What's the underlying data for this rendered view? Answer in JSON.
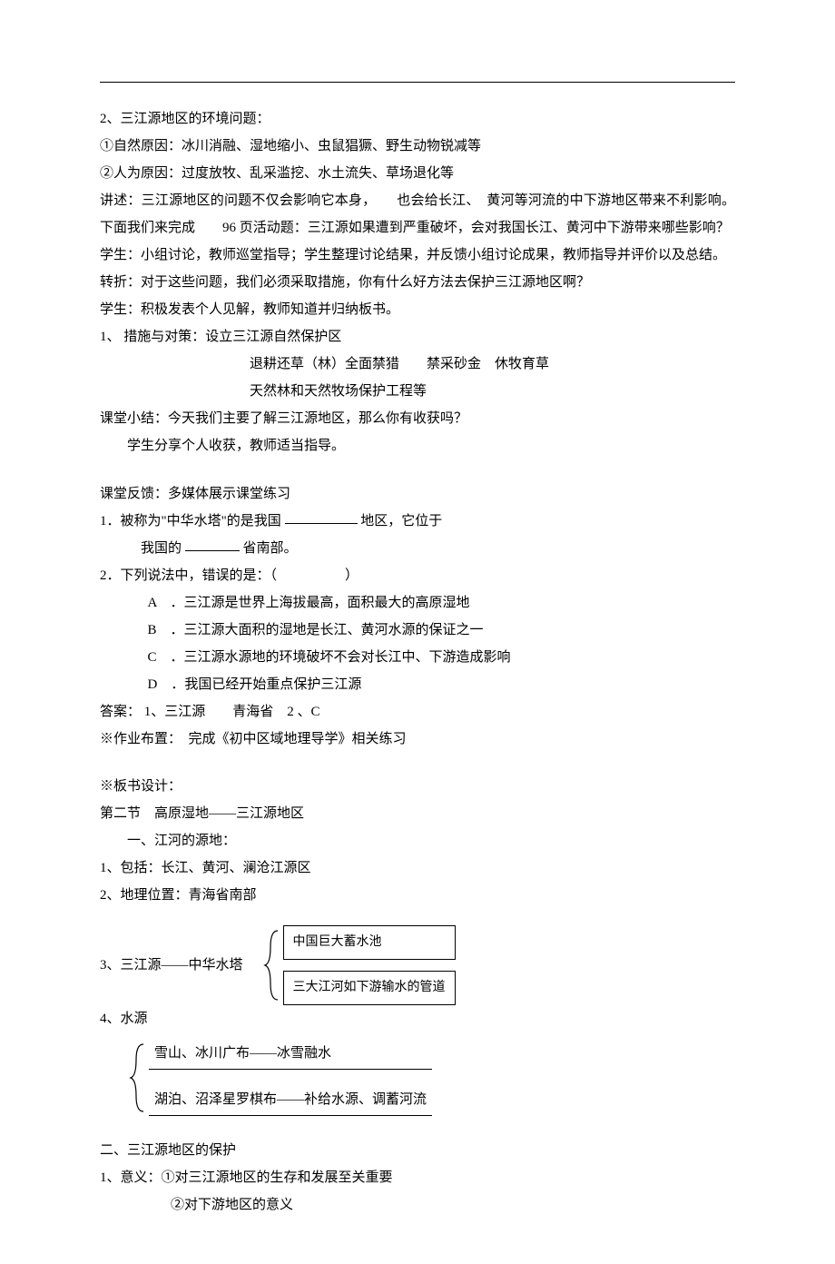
{
  "l1": "2、三江源地区的环境问题：",
  "l2": "①自然原因：冰川消融、湿地缩小、虫鼠猖獗、野生动物锐减等",
  "l3": "②人为原因：过度放牧、乱采滥挖、水土流失、草场退化等",
  "l4": "讲述：三江源地区的问题不仅会影响它本身，　　也会给长江、　黄河等河流的中下游地区带来不利影响。下面我们来完成　　96 页活动题：三江源如果遭到严重破坏，会对我国长江、黄河中下游带来哪些影响？",
  "l5": "学生：小组讨论，教师巡堂指导；学生整理讨论结果，并反馈小组讨论成果，教师指导并评价以及总结。",
  "l6": "转折：对于这些问题，我们必须采取措施，你有什么好方法去保护三江源地区啊？",
  "l7": "学生：积极发表个人见解，教师知道并归纳板书。",
  "l8": "1、 措施与对策：设立三江源自然保护区",
  "l9": "退耕还草（林）全面禁猎　　禁采砂金　休牧育草",
  "l10": "天然林和天然牧场保护工程等",
  "l11": "课堂小结：今天我们主要了解三江源地区，那么你有收获吗？",
  "l12": "学生分享个人收获，教师适当指导。",
  "l13": "课堂反馈：多媒体展示课堂练习",
  "q1a": "1．被称为\"中华水塔\"的是我国",
  "q1b": "地区，它位于",
  "q1c": "我国的",
  "q1d": "省南部。",
  "q2": "2．下列说法中，错误的是：（　　　　　）",
  "optA": "A　．三江源是世界上海拔最高，面积最大的高原湿地",
  "optB": "B　．三江源大面积的湿地是长江、黄河水源的保证之一",
  "optC": "C　．三江源水源地的环境破坏不会对长江中、下游造成影响",
  "optD": "D　．我国已经开始重点保护三江源",
  "ans": "答案： 1、三江源　　青海省　2 、C",
  "hw": "※作业布置：　完成《初中区域地理导学》相关练习",
  "bd": "※板书设计：",
  "bd1": "第二节　高原湿地——三江源地区",
  "bd2": "一、江河的源地：",
  "bd3": "1、包括：长江、黄河、澜沧江源区",
  "bd4": "2、地理位置：青海省南部",
  "bd5": "3、三江源——中华水塔",
  "box1": "中国巨大蓄水池",
  "box2": "三大江河如下游输水的管道",
  "bd6": "4、水源",
  "sub1": "雪山、冰川广布——冰雪融水",
  "sub2": "湖泊、沼泽星罗棋布——补给水源、调蓄河流",
  "sec2": "二、三江源地区的保护",
  "m1": "1、意义：①对三江源地区的生存和发展至关重要",
  "m2": "②对下游地区的意义"
}
